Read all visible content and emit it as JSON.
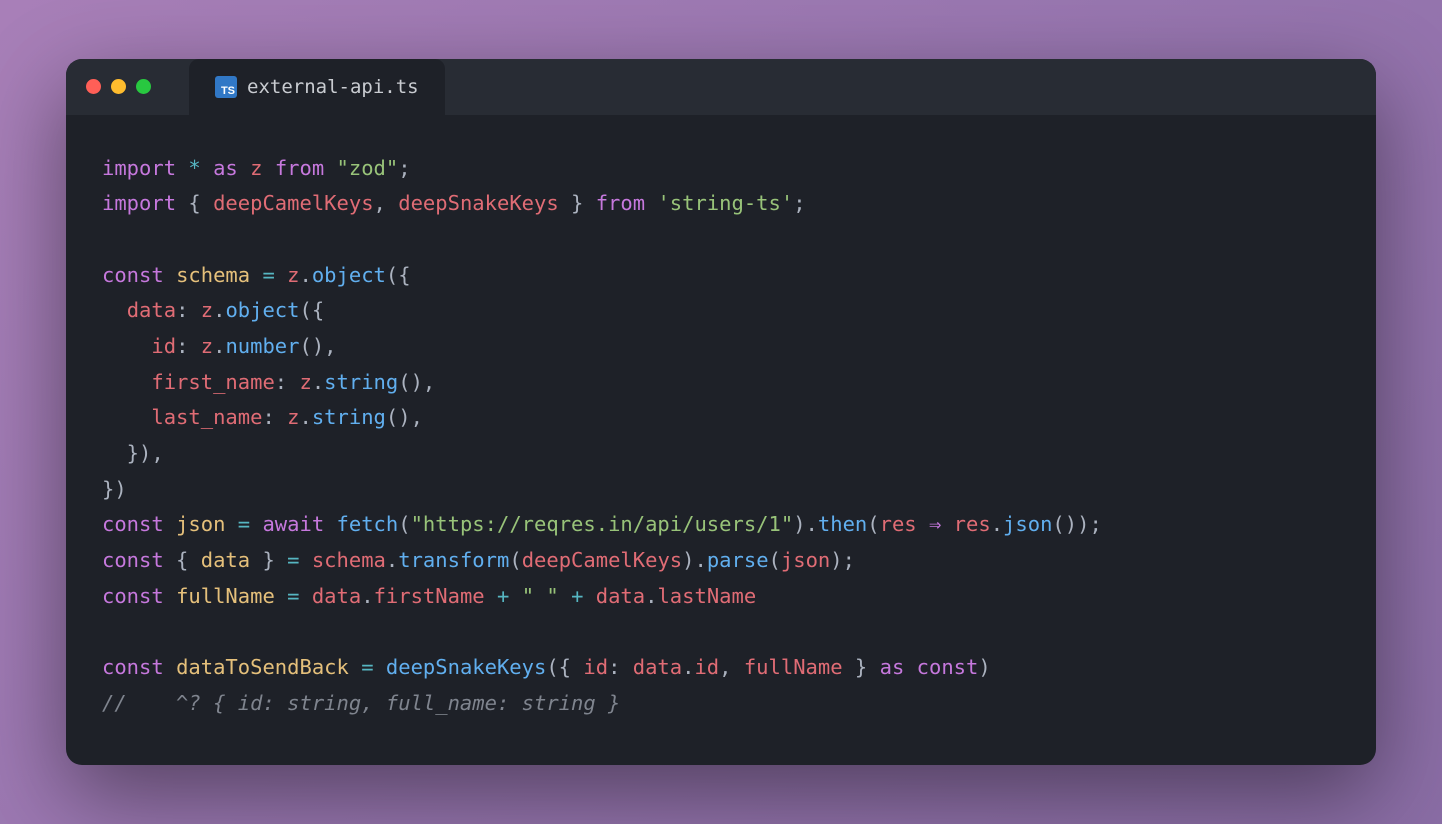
{
  "tab": {
    "icon_text": "TS",
    "filename": "external-api.ts"
  },
  "code": {
    "tokens": [
      [
        [
          "tk-kw",
          "import"
        ],
        [
          "tk-punc",
          " "
        ],
        [
          "tk-op",
          "*"
        ],
        [
          "tk-punc",
          " "
        ],
        [
          "tk-kw",
          "as"
        ],
        [
          "tk-punc",
          " "
        ],
        [
          "tk-id",
          "z"
        ],
        [
          "tk-punc",
          " "
        ],
        [
          "tk-kw",
          "from"
        ],
        [
          "tk-punc",
          " "
        ],
        [
          "tk-str",
          "\"zod\""
        ],
        [
          "tk-punc",
          ";"
        ]
      ],
      [
        [
          "tk-kw",
          "import"
        ],
        [
          "tk-punc",
          " { "
        ],
        [
          "tk-id",
          "deepCamelKeys"
        ],
        [
          "tk-punc",
          ", "
        ],
        [
          "tk-id",
          "deepSnakeKeys"
        ],
        [
          "tk-punc",
          " } "
        ],
        [
          "tk-kw",
          "from"
        ],
        [
          "tk-punc",
          " "
        ],
        [
          "tk-str",
          "'string-ts'"
        ],
        [
          "tk-punc",
          ";"
        ]
      ],
      [
        [
          "",
          " "
        ]
      ],
      [
        [
          "tk-kw",
          "const"
        ],
        [
          "tk-punc",
          " "
        ],
        [
          "tk-var",
          "schema"
        ],
        [
          "tk-punc",
          " "
        ],
        [
          "tk-op",
          "="
        ],
        [
          "tk-punc",
          " "
        ],
        [
          "tk-id",
          "z"
        ],
        [
          "tk-punc",
          "."
        ],
        [
          "tk-fn",
          "object"
        ],
        [
          "tk-punc",
          "({"
        ]
      ],
      [
        [
          "tk-punc",
          "  "
        ],
        [
          "tk-id",
          "data"
        ],
        [
          "tk-punc",
          ": "
        ],
        [
          "tk-id",
          "z"
        ],
        [
          "tk-punc",
          "."
        ],
        [
          "tk-fn",
          "object"
        ],
        [
          "tk-punc",
          "({"
        ]
      ],
      [
        [
          "tk-punc",
          "    "
        ],
        [
          "tk-id",
          "id"
        ],
        [
          "tk-punc",
          ": "
        ],
        [
          "tk-id",
          "z"
        ],
        [
          "tk-punc",
          "."
        ],
        [
          "tk-fn",
          "number"
        ],
        [
          "tk-punc",
          "(),"
        ]
      ],
      [
        [
          "tk-punc",
          "    "
        ],
        [
          "tk-id",
          "first_name"
        ],
        [
          "tk-punc",
          ": "
        ],
        [
          "tk-id",
          "z"
        ],
        [
          "tk-punc",
          "."
        ],
        [
          "tk-fn",
          "string"
        ],
        [
          "tk-punc",
          "(),"
        ]
      ],
      [
        [
          "tk-punc",
          "    "
        ],
        [
          "tk-id",
          "last_name"
        ],
        [
          "tk-punc",
          ": "
        ],
        [
          "tk-id",
          "z"
        ],
        [
          "tk-punc",
          "."
        ],
        [
          "tk-fn",
          "string"
        ],
        [
          "tk-punc",
          "(),"
        ]
      ],
      [
        [
          "tk-punc",
          "  }),"
        ]
      ],
      [
        [
          "tk-punc",
          "})"
        ]
      ],
      [
        [
          "tk-kw",
          "const"
        ],
        [
          "tk-punc",
          " "
        ],
        [
          "tk-var",
          "json"
        ],
        [
          "tk-punc",
          " "
        ],
        [
          "tk-op",
          "="
        ],
        [
          "tk-punc",
          " "
        ],
        [
          "tk-kw",
          "await"
        ],
        [
          "tk-punc",
          " "
        ],
        [
          "tk-fn",
          "fetch"
        ],
        [
          "tk-punc",
          "("
        ],
        [
          "tk-str",
          "\"https://reqres.in/api/users/1\""
        ],
        [
          "tk-punc",
          ")."
        ],
        [
          "tk-fn",
          "then"
        ],
        [
          "tk-punc",
          "("
        ],
        [
          "tk-id",
          "res"
        ],
        [
          "tk-punc",
          " "
        ],
        [
          "tk-arrow",
          "⇒"
        ],
        [
          "tk-punc",
          " "
        ],
        [
          "tk-id",
          "res"
        ],
        [
          "tk-punc",
          "."
        ],
        [
          "tk-fn",
          "json"
        ],
        [
          "tk-punc",
          "());"
        ]
      ],
      [
        [
          "tk-kw",
          "const"
        ],
        [
          "tk-punc",
          " { "
        ],
        [
          "tk-var",
          "data"
        ],
        [
          "tk-punc",
          " } "
        ],
        [
          "tk-op",
          "="
        ],
        [
          "tk-punc",
          " "
        ],
        [
          "tk-id",
          "schema"
        ],
        [
          "tk-punc",
          "."
        ],
        [
          "tk-fn",
          "transform"
        ],
        [
          "tk-punc",
          "("
        ],
        [
          "tk-id",
          "deepCamelKeys"
        ],
        [
          "tk-punc",
          ")."
        ],
        [
          "tk-fn",
          "parse"
        ],
        [
          "tk-punc",
          "("
        ],
        [
          "tk-id",
          "json"
        ],
        [
          "tk-punc",
          ");"
        ]
      ],
      [
        [
          "tk-kw",
          "const"
        ],
        [
          "tk-punc",
          " "
        ],
        [
          "tk-var",
          "fullName"
        ],
        [
          "tk-punc",
          " "
        ],
        [
          "tk-op",
          "="
        ],
        [
          "tk-punc",
          " "
        ],
        [
          "tk-id",
          "data"
        ],
        [
          "tk-punc",
          "."
        ],
        [
          "tk-id",
          "firstName"
        ],
        [
          "tk-punc",
          " "
        ],
        [
          "tk-op",
          "+"
        ],
        [
          "tk-punc",
          " "
        ],
        [
          "tk-str",
          "\" \""
        ],
        [
          "tk-punc",
          " "
        ],
        [
          "tk-op",
          "+"
        ],
        [
          "tk-punc",
          " "
        ],
        [
          "tk-id",
          "data"
        ],
        [
          "tk-punc",
          "."
        ],
        [
          "tk-id",
          "lastName"
        ]
      ],
      [
        [
          "",
          " "
        ]
      ],
      [
        [
          "tk-kw",
          "const"
        ],
        [
          "tk-punc",
          " "
        ],
        [
          "tk-var",
          "dataToSendBack"
        ],
        [
          "tk-punc",
          " "
        ],
        [
          "tk-op",
          "="
        ],
        [
          "tk-punc",
          " "
        ],
        [
          "tk-fn",
          "deepSnakeKeys"
        ],
        [
          "tk-punc",
          "({ "
        ],
        [
          "tk-id",
          "id"
        ],
        [
          "tk-punc",
          ": "
        ],
        [
          "tk-id",
          "data"
        ],
        [
          "tk-punc",
          "."
        ],
        [
          "tk-id",
          "id"
        ],
        [
          "tk-punc",
          ", "
        ],
        [
          "tk-id",
          "fullName"
        ],
        [
          "tk-punc",
          " } "
        ],
        [
          "tk-kw",
          "as"
        ],
        [
          "tk-punc",
          " "
        ],
        [
          "tk-kw",
          "const"
        ],
        [
          "tk-punc",
          ")"
        ]
      ],
      [
        [
          "tk-com",
          "//    ^? { id: string, full_name: string }"
        ]
      ]
    ]
  }
}
